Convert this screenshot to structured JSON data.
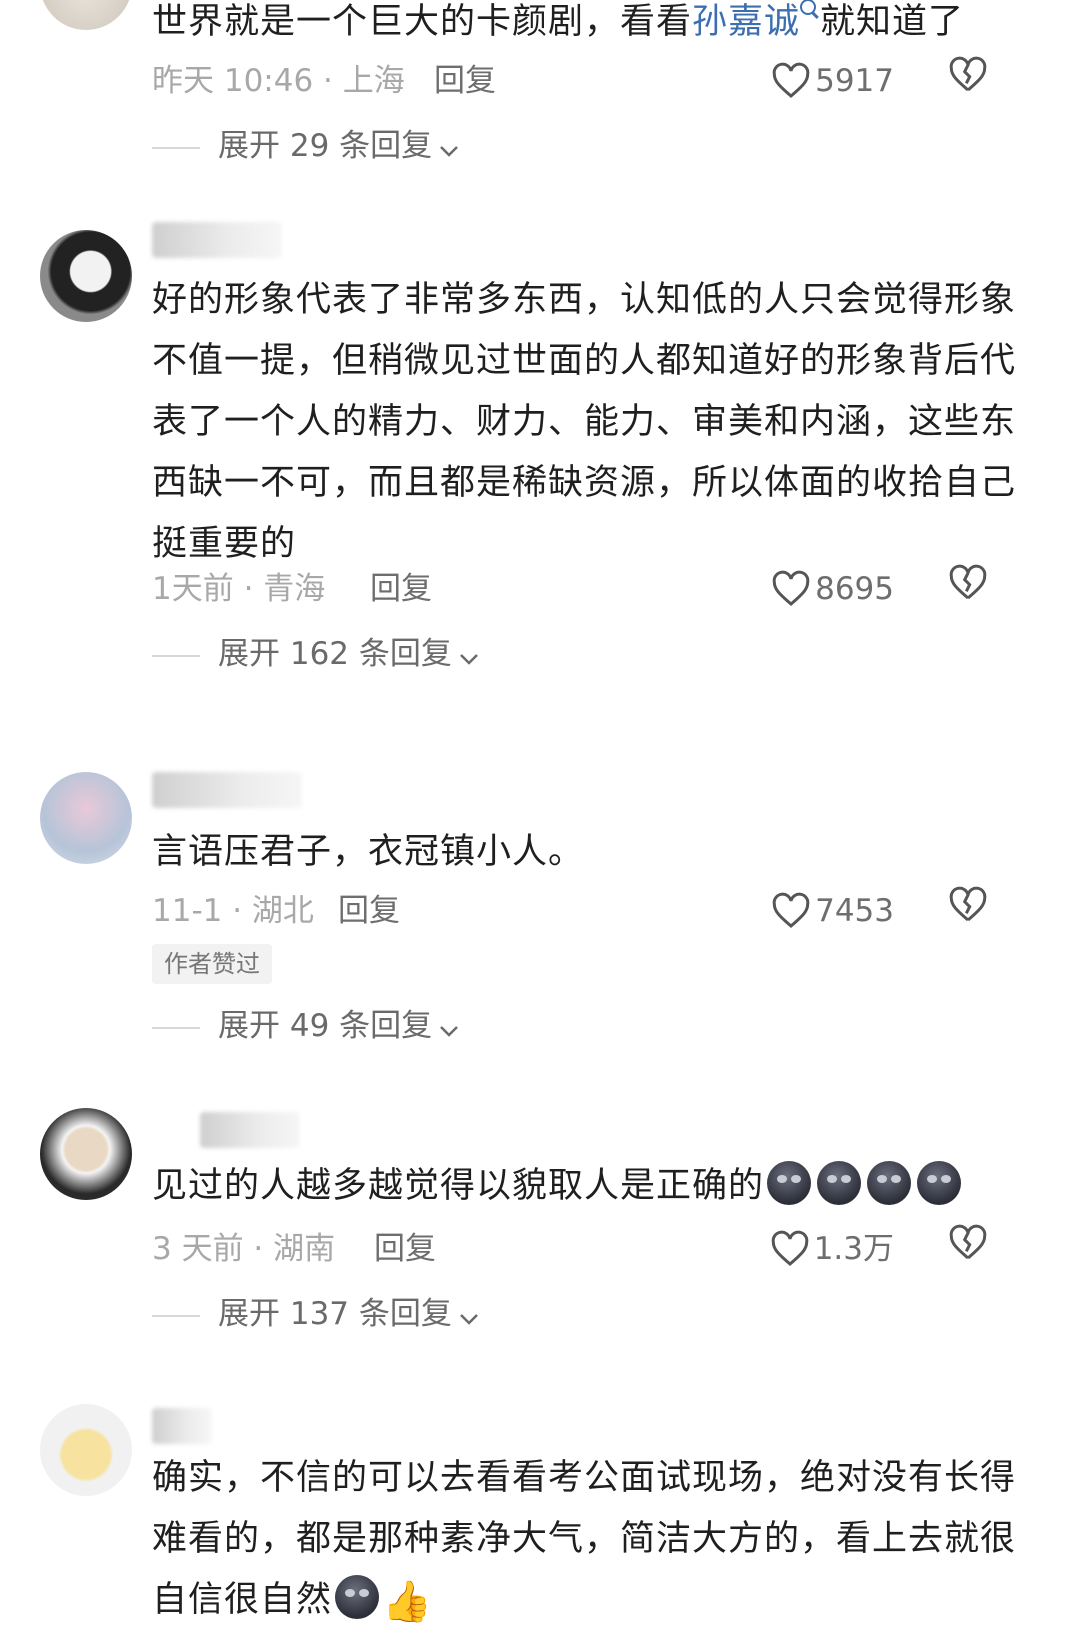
{
  "comments": [
    {
      "text_before": "世界就是一个巨大的卡颜剧，看看",
      "link": "孙嘉诚",
      "text_after": "就知道了",
      "time_location": "昨天 10:46 · 上海",
      "reply_label": "回复",
      "likes": "5917",
      "expand_label": "展开 29 条回复"
    },
    {
      "username": "宋领",
      "text": "好的形象代表了非常多东西，认知低的人只会觉得形象不值一提，但稍微见过世面的人都知道好的形象背后代表了一个人的精力、财力、能力、审美和内涵，这些东西缺一不可，而且都是稀缺资源，所以体面的收拾自己挺重要的",
      "time_location": "1天前 · 青海",
      "reply_label": "回复",
      "likes": "8695",
      "expand_label": "展开 162 条回复"
    },
    {
      "username": "清哥哥~",
      "text": "言语压君子，衣冠镇小人。",
      "time_location": "11-1 · 湖北",
      "reply_label": "回复",
      "likes": "7453",
      "badge": "作者赞过",
      "expand_label": "展开 49 条回复"
    },
    {
      "text": "见过的人越多越觉得以貌取人是正确的",
      "emoji": "dark-moon-face",
      "time_location": "3 天前 · 湖南",
      "reply_label": "回复",
      "likes": "1.3万",
      "expand_label": "展开 137 条回复"
    },
    {
      "username": "张",
      "text": "确实，不信的可以去看看考公面试现场，绝对没有长得难看的，都是那种素净大气，简洁大方的，看上去就很自信很自然",
      "emoji": "dark-moon-face",
      "emoji2": "thumbs-up"
    }
  ],
  "icons": {
    "like": "heart-outline-icon",
    "dislike": "broken-heart-icon",
    "expand": "chevron-down-icon",
    "search": "search-icon"
  },
  "colors": {
    "link": "#3d6fb0",
    "meta": "#a8a8a8",
    "text": "#1f1f1f"
  }
}
